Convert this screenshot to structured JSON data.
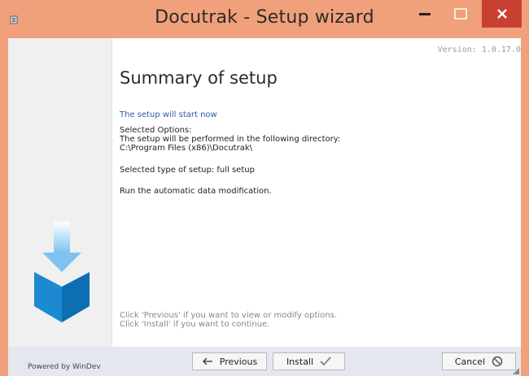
{
  "window": {
    "title": "Docutrak - Setup wizard",
    "version": "Version: 1.0.17.0"
  },
  "summary": {
    "heading": "Summary of setup",
    "start_line": "The setup will start now",
    "options_label": "Selected Options:",
    "directory_line": "The setup will be performed in the following directory:",
    "directory_path": "C:\\Program Files (x86)\\Docutrak\\",
    "setup_type": "Selected type of setup: full setup",
    "data_mod": "Run the automatic data modification.",
    "hint_previous": "Click 'Previous' if you want to view or modify options.",
    "hint_install": "Click 'Install' if you want to continue."
  },
  "footer": {
    "powered_by": "Powered by WinDev",
    "previous_label": "Previous",
    "install_label": "Install",
    "cancel_label": "Cancel"
  },
  "icons": {
    "app": "installer-app-icon",
    "logo": "download-box-icon",
    "previous": "arrow-left-icon",
    "install": "checkmark-icon",
    "cancel": "cancel-circle-icon"
  },
  "colors": {
    "titlebar": "#f0a07a",
    "close_button": "#c84031",
    "link_text": "#2a5da8",
    "logo_blue": "#1c8ad0"
  }
}
